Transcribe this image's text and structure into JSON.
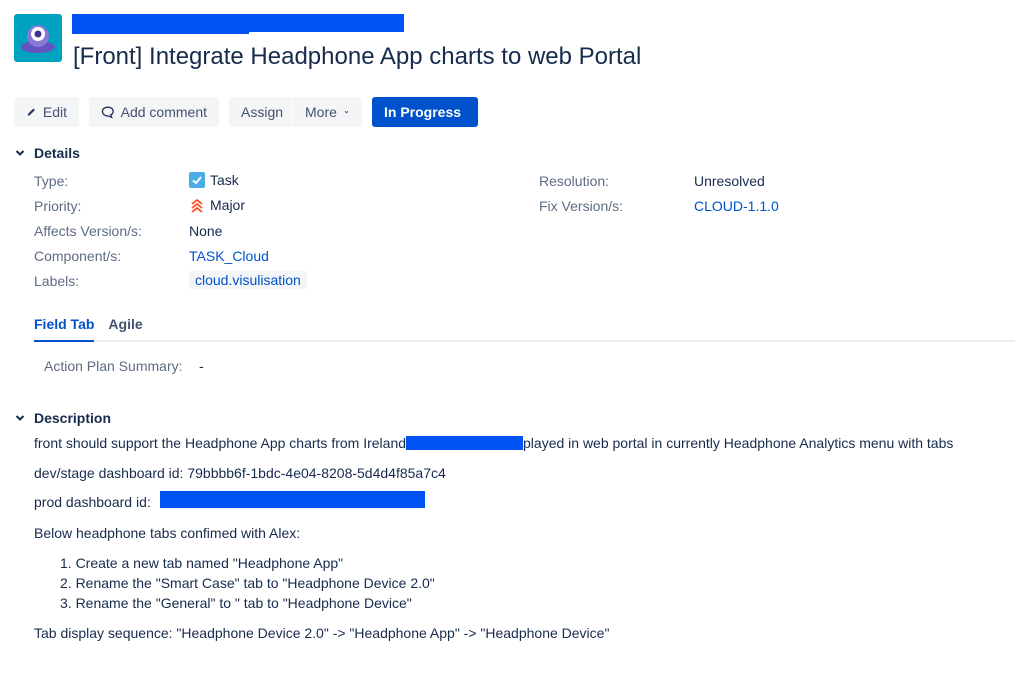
{
  "header": {
    "title": "[Front] Integrate Headphone App charts to web Portal"
  },
  "toolbar": {
    "edit_label": "Edit",
    "comment_label": "Add comment",
    "assign_label": "Assign",
    "more_label": "More",
    "status_label": "In Progress"
  },
  "details": {
    "heading": "Details",
    "type_label": "Type:",
    "type_value": "Task",
    "priority_label": "Priority:",
    "priority_value": "Major",
    "affects_label": "Affects Version/s:",
    "affects_value": "None",
    "component_label": "Component/s:",
    "component_value": "TASK_Cloud",
    "labels_label": "Labels:",
    "labels_value": "cloud.visulisation",
    "resolution_label": "Resolution:",
    "resolution_value": "Unresolved",
    "fixversion_label": "Fix Version/s:",
    "fixversion_value": "CLOUD-1.1.0"
  },
  "tabs": [
    {
      "label": "Field Tab"
    },
    {
      "label": "Agile"
    }
  ],
  "field_tab": {
    "action_plan_label": "Action Plan Summary:",
    "action_plan_value": "-"
  },
  "description": {
    "heading": "Description",
    "line1_start": "front should support the Headphone App charts from Ireland",
    "line1_end": "played in web portal in currently Headphone Analytics menu with tabs",
    "line2": "dev/stage dashboard id: 79bbbb6f-1bdc-4e04-8208-5d4d4f85a7c4",
    "line3": " prod dashboard id:",
    "line4": "Below headphone tabs confimed with Alex:",
    "list": [
      "1. Create a new tab named \"Headphone App\"",
      "2. Rename the \"Smart Case\" tab to \"Headphone Device 2.0\"",
      "3. Rename the \"General\" to \" tab to \"Headphone Device\""
    ],
    "line5": "Tab display sequence: \"Headphone Device 2.0\" -> \"Headphone App\" -> \"Headphone Device\""
  },
  "colors": {
    "accent": "#0052cc",
    "redaction": "#0052f5",
    "avatar": "#00a3bf"
  }
}
